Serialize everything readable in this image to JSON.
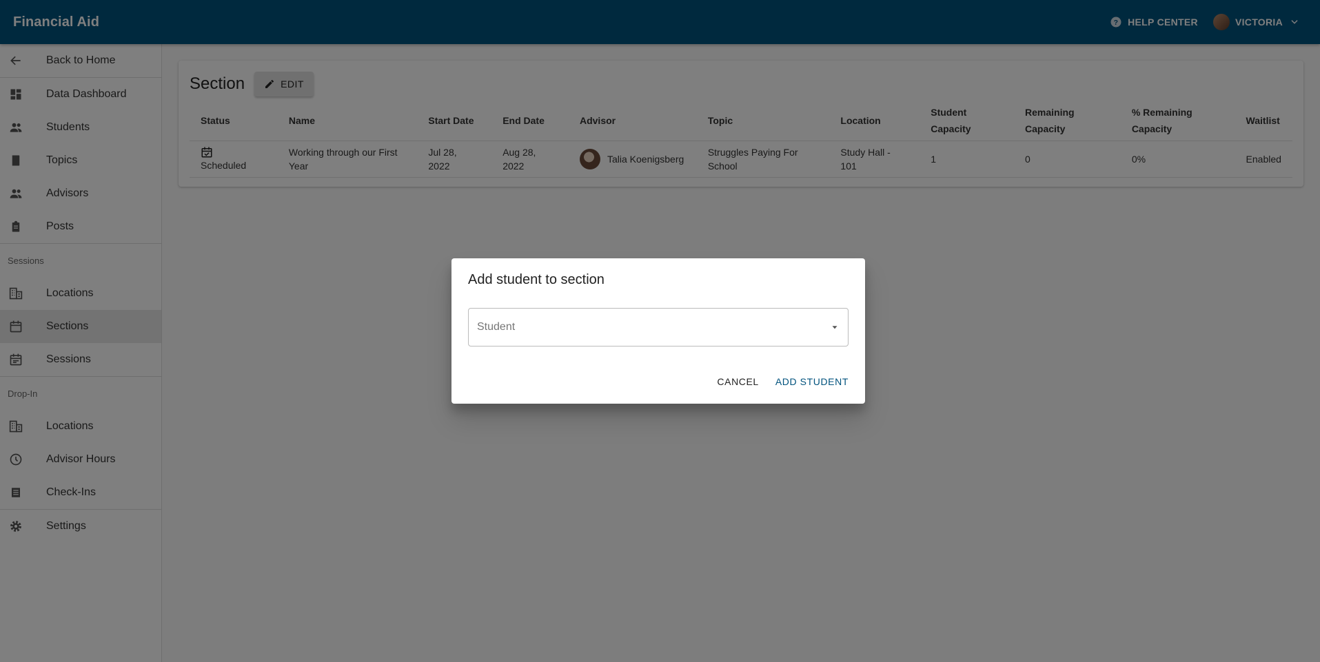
{
  "app": {
    "title": "Financial Aid"
  },
  "topbar": {
    "help_label": "HELP CENTER",
    "user_name": "VICTORIA"
  },
  "sidebar": {
    "back": "Back to Home",
    "items": [
      "Data Dashboard",
      "Students",
      "Topics",
      "Advisors",
      "Posts"
    ],
    "sessions_group": "Sessions",
    "sessions_items": [
      "Locations",
      "Sections",
      "Sessions"
    ],
    "dropin_group": "Drop-In",
    "dropin_items": [
      "Locations",
      "Advisor Hours",
      "Check-Ins"
    ],
    "settings": "Settings",
    "active": "Sections"
  },
  "section": {
    "title": "Section",
    "edit_label": "EDIT",
    "columns": [
      "Status",
      "Name",
      "Start Date",
      "End Date",
      "Advisor",
      "Topic",
      "Location",
      "Student Capacity",
      "Remaining Capacity",
      "% Remaining Capacity",
      "Waitlist"
    ],
    "row": {
      "status": "Scheduled",
      "name": "Working through our First Year",
      "start_date": "Jul 28, 2022",
      "end_date": "Aug 28, 2022",
      "advisor": "Talia Koenigsberg",
      "topic": "Struggles Paying For School",
      "location": "Study Hall - 101",
      "student_capacity": "1",
      "remaining_capacity": "0",
      "pct_remaining": "0%",
      "waitlist": "Enabled"
    }
  },
  "dialog": {
    "title": "Add student to section",
    "select_placeholder": "Student",
    "cancel_label": "CANCEL",
    "confirm_label": "ADD STUDENT"
  },
  "colors": {
    "primary": "#00527d"
  }
}
